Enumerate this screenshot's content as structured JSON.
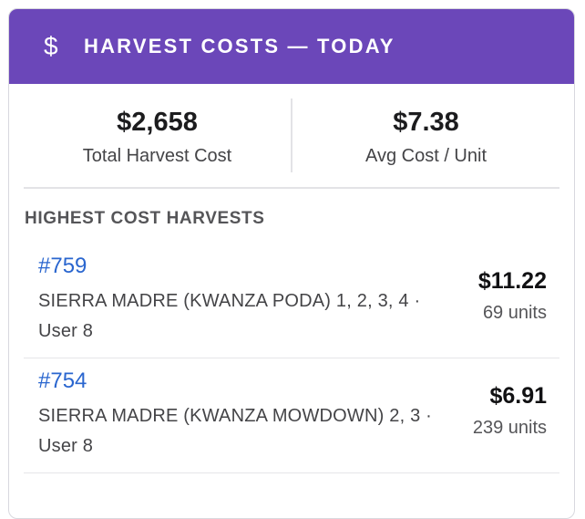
{
  "header": {
    "icon": "dollar-icon",
    "icon_glyph": "$",
    "title": "HARVEST COSTS — TODAY",
    "bg_color": "#6b47b9"
  },
  "stats": [
    {
      "value": "$2,658",
      "label": "Total Harvest Cost"
    },
    {
      "value": "$7.38",
      "label": "Avg Cost / Unit"
    }
  ],
  "section": {
    "title": "HIGHEST COST HARVESTS"
  },
  "harvests": [
    {
      "id": "#759",
      "description": "SIERRA MADRE (KWANZA PODA) 1, 2, 3, 4 · User 8",
      "cost": "$11.22",
      "units": "69 units"
    },
    {
      "id": "#754",
      "description": "SIERRA MADRE (KWANZA MOWDOWN) 2, 3 · User 8",
      "cost": "$6.91",
      "units": "239 units"
    }
  ],
  "colors": {
    "link": "#2a66cf",
    "accent": "#6b47b9"
  }
}
